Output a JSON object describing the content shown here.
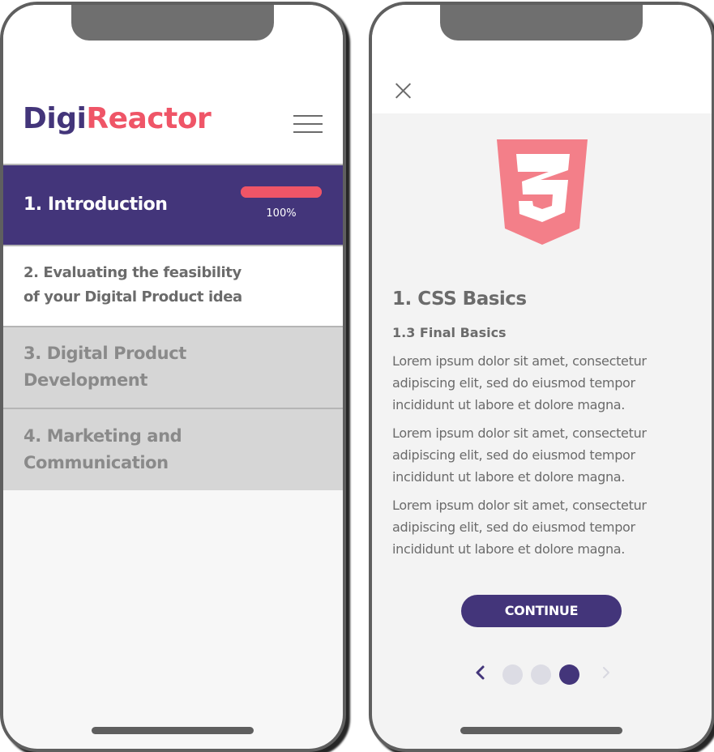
{
  "left_phone": {
    "brand": {
      "part1": "Digi",
      "part2": "Reactor"
    },
    "modules": [
      {
        "title": "1. Introduction",
        "progress_percent": 100,
        "progress_label": "100%"
      },
      {
        "lines": [
          "2. Evaluating the feasibility",
          "of your Digital Product idea"
        ]
      },
      {
        "lines": [
          "3. Digital Product",
          "Development"
        ]
      },
      {
        "lines": [
          "4. Marketing and",
          "Communication"
        ]
      }
    ]
  },
  "right_phone": {
    "lesson_title": "1. CSS Basics",
    "lesson_subtitle": "1.3 Final Basics",
    "paragraphs": [
      [
        "Lorem ipsum dolor sit amet, consectetur",
        "adipiscing elit, sed do eiusmod tempor",
        "incididunt ut labore et dolore magna."
      ],
      [
        "Lorem ipsum dolor sit amet, consectetur",
        "adipiscing elit, sed do eiusmod tempor",
        "incididunt ut labore et dolore magna."
      ],
      [
        "Lorem ipsum dolor sit amet, consectetur",
        "adipiscing elit, sed do eiusmod tempor",
        "incididunt ut labore et dolore magna."
      ]
    ],
    "continue_label": "CONTINUE",
    "pager": {
      "total": 3,
      "current": 3
    }
  },
  "colors": {
    "brand_dark": "#43357a",
    "brand_accent": "#ef5567",
    "css_logo": "#f37f89",
    "text_gray": "#6b6b6b"
  },
  "icons": [
    "hamburger-menu-icon",
    "close-icon",
    "css3-logo-icon",
    "chevron-left-icon",
    "chevron-right-icon"
  ]
}
